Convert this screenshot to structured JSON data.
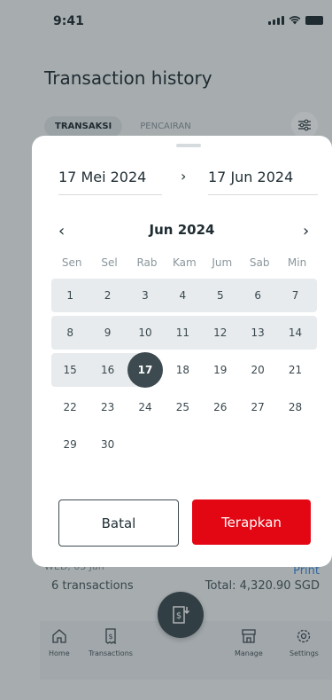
{
  "status_bar": {
    "time": "9:41"
  },
  "page": {
    "title": "Transaction history",
    "tabs": [
      {
        "label": "TRANSAKSI",
        "active": true
      },
      {
        "label": "PENCAIRAN",
        "active": false
      }
    ],
    "date_group": "WED, 03 Jan",
    "print_label": "Print",
    "transactions_count": "6 transactions",
    "total": "Total: 4,320.90 SGD"
  },
  "bottom_nav": {
    "items": [
      {
        "label": "Home",
        "icon": "home-icon"
      },
      {
        "label": "Transactions",
        "icon": "receipt-icon"
      },
      {
        "label": "Manage",
        "icon": "store-icon"
      },
      {
        "label": "Settings",
        "icon": "gear-icon"
      }
    ],
    "fab_icon": "download-receipt-icon"
  },
  "date_sheet": {
    "start_date": "17 Mei 2024",
    "end_date": "17 Jun 2024",
    "range_arrow": "›",
    "month_label": "Jun 2024",
    "prev_month": "‹",
    "next_month": "›",
    "weekdays": [
      "Sen",
      "Sel",
      "Rab",
      "Kam",
      "Jum",
      "Sab",
      "Min"
    ],
    "weeks": [
      [
        "1",
        "2",
        "3",
        "4",
        "5",
        "6",
        "7"
      ],
      [
        "8",
        "9",
        "10",
        "11",
        "12",
        "13",
        "14"
      ],
      [
        "15",
        "16",
        "17",
        "18",
        "19",
        "20",
        "21"
      ],
      [
        "22",
        "23",
        "24",
        "25",
        "26",
        "27",
        "28"
      ],
      [
        "29",
        "30",
        "",
        "",
        "",
        "",
        ""
      ]
    ],
    "selected_day": "17",
    "cancel_label": "Batal",
    "apply_label": "Terapkan"
  },
  "colors": {
    "accent_red": "#e30613",
    "selected_dark": "#3d4a50",
    "range_highlight": "#e7ebee",
    "link_blue": "#3a8be0"
  }
}
